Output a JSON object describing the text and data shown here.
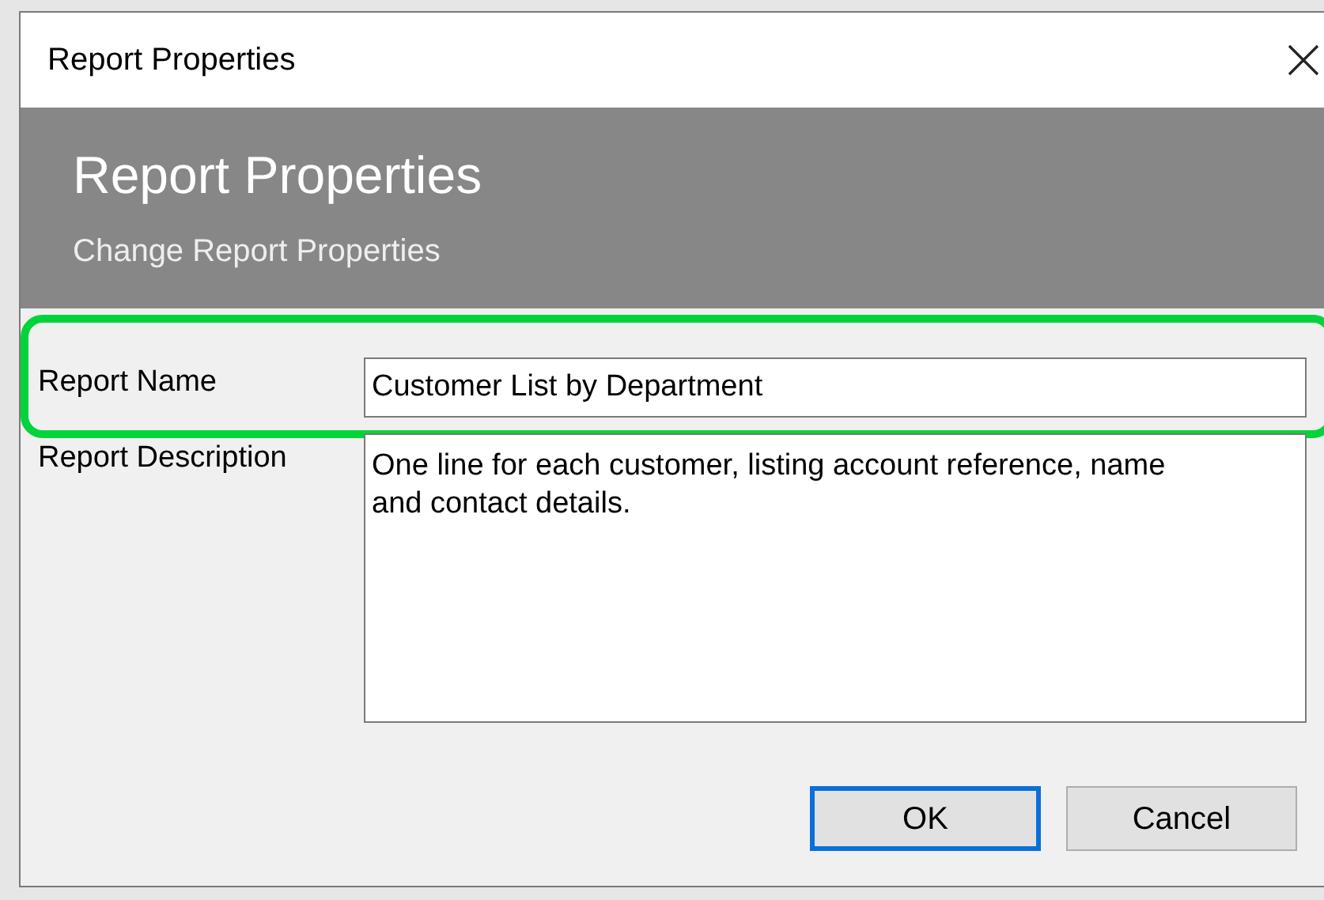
{
  "window": {
    "title": "Report Properties"
  },
  "header": {
    "title": "Report Properties",
    "subtitle": "Change Report Properties"
  },
  "fields": [
    {
      "kind": "text",
      "label": "Report Name",
      "value": "Customer List by Department",
      "highlighted": true
    },
    {
      "kind": "multiline",
      "label": "Report Description",
      "value": "One line for each customer, listing account reference, name and contact details.",
      "highlighted": false
    }
  ],
  "buttons": [
    {
      "label": "OK",
      "default": true
    },
    {
      "label": "Cancel",
      "default": false
    }
  ]
}
